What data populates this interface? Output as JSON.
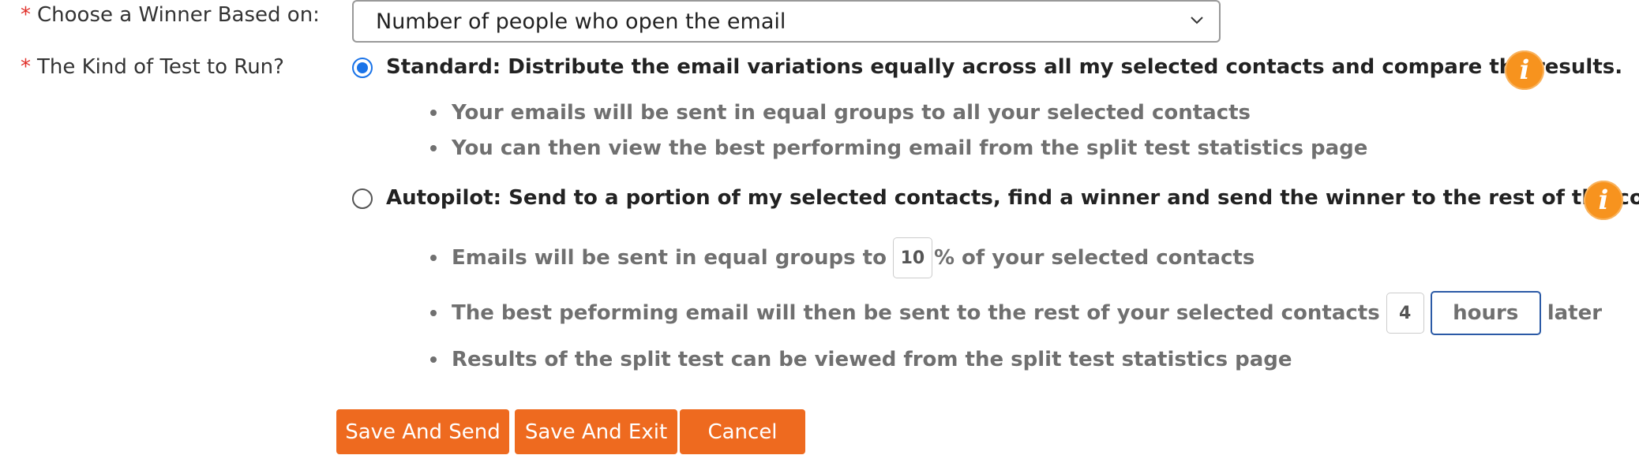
{
  "winner_row": {
    "required_mark": "*",
    "label": "Choose a Winner Based on:",
    "selected_value": "Number of people who open the email"
  },
  "test_row": {
    "required_mark": "*",
    "label": "The Kind of Test to Run?"
  },
  "standard_option": {
    "selected": true,
    "title": "Standard: Distribute the email variations equally across all my selected contacts and compare the results.",
    "bullets": [
      "Your emails will be sent in equal groups to all your selected contacts",
      "You can then view the best performing email from the split test statistics page"
    ],
    "info_icon": "i"
  },
  "autopilot_option": {
    "selected": false,
    "title": "Autopilot: Send to a portion of my selected contacts, find a winner and send the winner to the rest of the contacts",
    "info_icon": "i",
    "bullet1_prefix": "Emails will be sent in equal groups to",
    "percent_value": "10",
    "bullet1_suffix": "% of your selected contacts",
    "bullet2_prefix": "The best peforming email will then be sent to the rest of your selected contacts",
    "delay_value": "4",
    "delay_unit": "hours",
    "bullet2_suffix": "later",
    "bullet3": "Results of the split test can be viewed from the split test statistics page"
  },
  "actions": {
    "save_and_send": "Save And Send",
    "save_and_exit": "Save And Exit",
    "cancel": "Cancel"
  },
  "colors": {
    "accent_orange": "#ee6a1f",
    "info_orange": "#f7931e",
    "radio_blue": "#1a73e8",
    "required_red": "#e0302a"
  },
  "icons": {
    "select_arrow": "chevron-down-icon",
    "info": "info-icon"
  }
}
